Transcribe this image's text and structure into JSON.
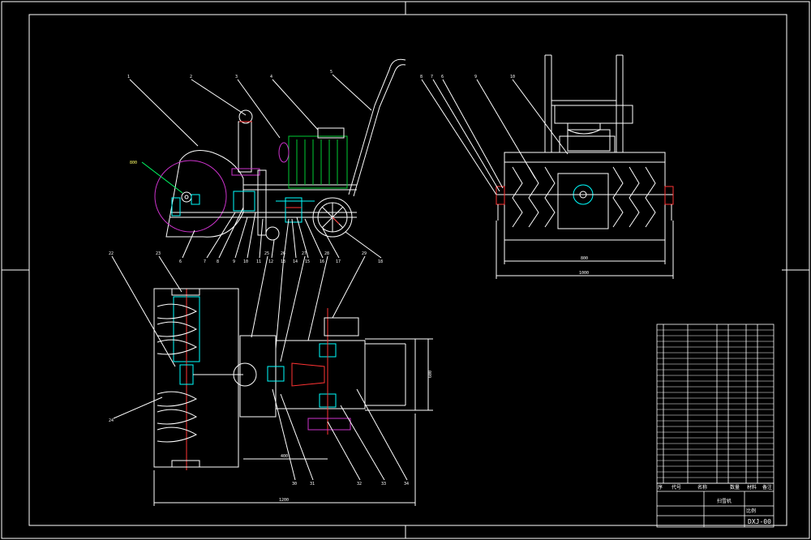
{
  "colors": {
    "background": "#000000",
    "line": "#ffffff",
    "motor": "#00cc33",
    "hydraulic": "#00ffff",
    "auger_housing": "#cc33cc",
    "accent_red": "#ff3333",
    "dimension": "#00ff66",
    "label_yellow": "#ffff66"
  },
  "views": {
    "side": {
      "leaders": [
        "1",
        "2",
        "3",
        "4",
        "5",
        "6",
        "7",
        "8",
        "9",
        "10",
        "11",
        "12",
        "13",
        "14",
        "15",
        "16",
        "17",
        "18",
        "19",
        "20",
        "21",
        "22",
        "23"
      ],
      "callout": "800"
    },
    "front": {
      "leaders": [
        "8",
        "7",
        "6",
        "9",
        "10"
      ],
      "dims": [
        "800",
        "1000"
      ]
    },
    "top": {
      "leaders": [
        "22",
        "23",
        "24",
        "25",
        "26",
        "27",
        "28",
        "29",
        "30",
        "31",
        "32",
        "33",
        "34"
      ],
      "dims": [
        "1200",
        "400",
        "600"
      ]
    }
  },
  "title_block": {
    "header_cells": [
      "序",
      "代号",
      "名称",
      "数量",
      "材料",
      "备注"
    ],
    "name_label": "扫雪机",
    "drawing_no": "DXJ-00",
    "scale_label": "比例"
  }
}
